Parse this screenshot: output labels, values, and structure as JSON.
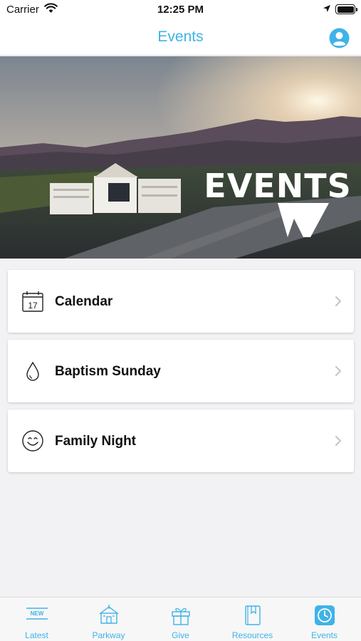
{
  "status": {
    "carrier": "Carrier",
    "time": "12:25 PM"
  },
  "nav": {
    "title": "Events",
    "profile_icon": "profile-icon"
  },
  "hero": {
    "overlay_text": "EVENTS"
  },
  "items": [
    {
      "label": "Calendar",
      "icon": "calendar-icon",
      "icon_text": "17"
    },
    {
      "label": "Baptism Sunday",
      "icon": "water-drop-icon"
    },
    {
      "label": "Family Night",
      "icon": "smiley-icon"
    }
  ],
  "tabs": [
    {
      "label": "Latest",
      "icon": "new-badge-icon",
      "icon_text": "NEW"
    },
    {
      "label": "Parkway",
      "icon": "church-building-icon"
    },
    {
      "label": "Give",
      "icon": "gift-icon"
    },
    {
      "label": "Resources",
      "icon": "book-icon"
    },
    {
      "label": "Events",
      "icon": "clock-icon",
      "selected": true
    }
  ],
  "colors": {
    "accent": "#3fb3e8",
    "background": "#f2f2f4"
  }
}
